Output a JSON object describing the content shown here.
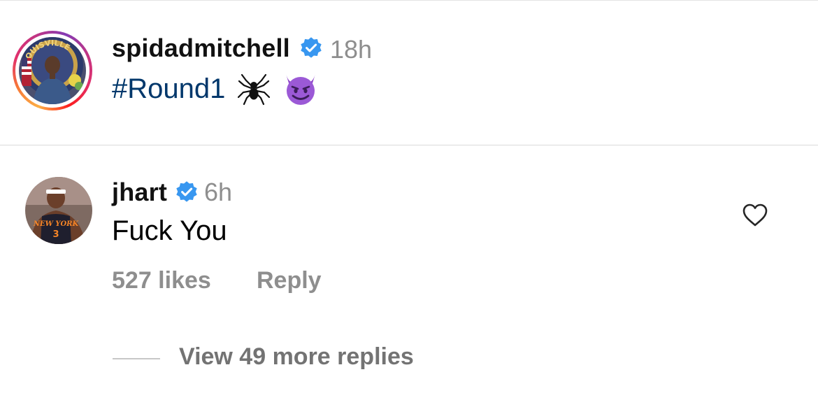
{
  "post": {
    "username": "spidadmitchell",
    "verified": true,
    "timestamp": "18h",
    "caption_hashtag": "#Round1",
    "caption_emojis": [
      "spider-icon",
      "smiling-imp-icon"
    ],
    "avatar_has_story_ring": true,
    "avatar_seal_text": "LOUISVILLE"
  },
  "comment": {
    "username": "jhart",
    "verified": true,
    "timestamp": "6h",
    "text": "Fuck You",
    "likes": "527 likes",
    "reply_label": "Reply",
    "jersey_text": "NEW YORK",
    "jersey_number": "3"
  },
  "replies": {
    "view_more_label": "View 49 more replies"
  },
  "colors": {
    "hashtag": "#00376b",
    "verified": "#3897f0",
    "secondary_text": "#8e8e8e",
    "divider": "#dbdbdb"
  }
}
